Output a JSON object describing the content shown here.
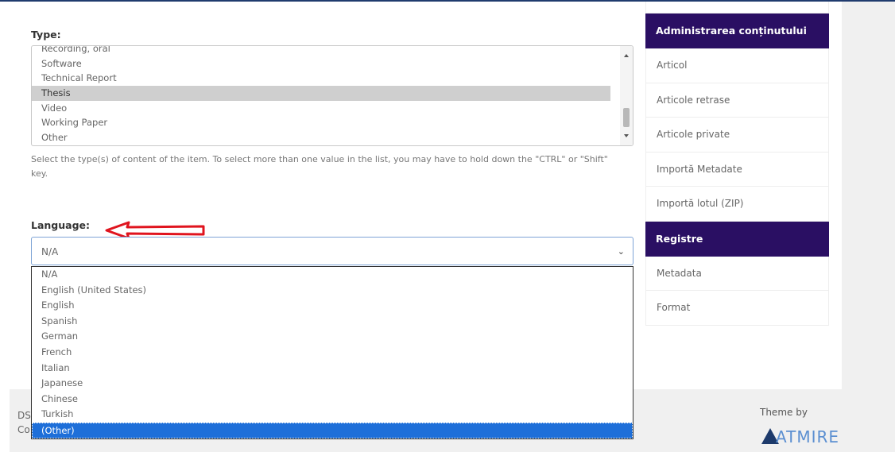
{
  "type_field": {
    "label": "Type:",
    "options": [
      "Recording, oral",
      "Software",
      "Technical Report",
      "Thesis",
      "Video",
      "Working Paper",
      "Other"
    ],
    "selected": "Thesis",
    "help": "Select the type(s) of content of the item. To select more than one value in the list, you may have to hold down the \"CTRL\" or \"Shift\" key."
  },
  "language_field": {
    "label": "Language:",
    "value": "N/A",
    "options": [
      "N/A",
      "English (United States)",
      "English",
      "Spanish",
      "German",
      "French",
      "Italian",
      "Japanese",
      "Chinese",
      "Turkish",
      "(Other)"
    ],
    "highlighted": "(Other)"
  },
  "sidebar": {
    "sections": [
      {
        "title": "Administrarea conținutului",
        "items": [
          "Articol",
          "Articole retrase",
          "Articole private",
          "Importă Metadate",
          "Importă lotul (ZIP)"
        ]
      },
      {
        "title": "Registre",
        "items": [
          "Metadata",
          "Format"
        ]
      }
    ]
  },
  "footer": {
    "left_lines": [
      "DS",
      "Co"
    ],
    "theme_by": "Theme by",
    "brand": "ATMIRE"
  },
  "colors": {
    "sidebar_header": "#2a0f63",
    "highlight": "#1e6fd9",
    "annotation_arrow": "#e0141e"
  }
}
